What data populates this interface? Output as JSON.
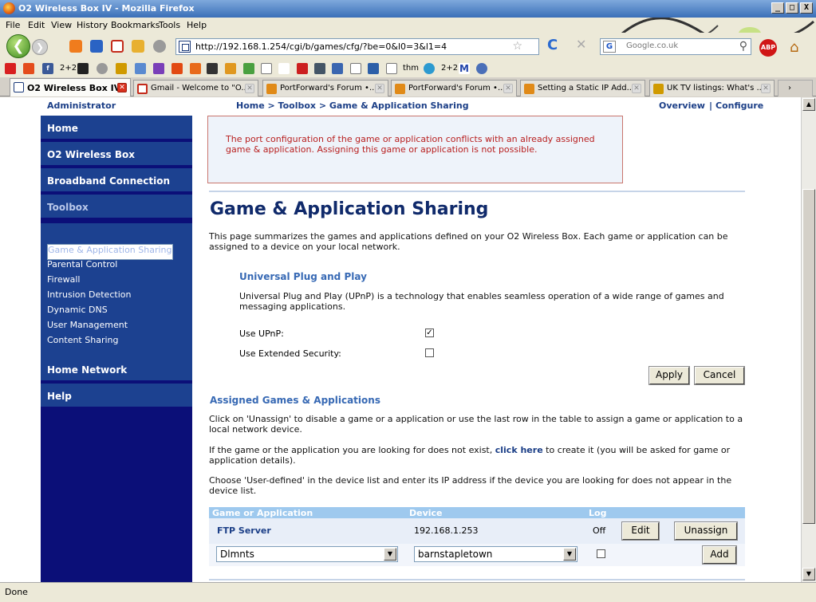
{
  "window": {
    "title": "O2 Wireless Box IV - Mozilla Firefox",
    "buttons": [
      "_",
      "□",
      "X"
    ]
  },
  "menu": [
    "File",
    "Edit",
    "View",
    "History",
    "Bookmarks",
    "Tools",
    "Help"
  ],
  "nav": {
    "url": "http://192.168.1.254/cgi/b/games/cfg/?be=0&l0=3&l1=4",
    "search_placeholder": "Google.co.uk",
    "search_engine": "G",
    "abp": "ABP"
  },
  "bookmarks": {
    "labels": [
      "2+2",
      "thm",
      "2+2"
    ]
  },
  "tabs": [
    {
      "label": "O2 Wireless Box IV",
      "active": true
    },
    {
      "label": "Gmail - Welcome to \"O..."
    },
    {
      "label": "PortForward's Forum •..."
    },
    {
      "label": "PortForward's Forum •..."
    },
    {
      "label": "Setting a Static IP Add..."
    },
    {
      "label": "UK TV listings: What's ..."
    }
  ],
  "page": {
    "topnav": {
      "left": "Administrator",
      "breadcrumb": "Home > Toolbox > Game & Application Sharing",
      "overview": "Overview",
      "sep": "|",
      "configure": "Configure"
    },
    "sidebar": {
      "items": [
        "Home",
        "O2 Wireless Box",
        "Broadband Connection",
        "Toolbox",
        "Home Network",
        "Help"
      ],
      "sub": [
        "Game & Application Sharing",
        "Parental Control",
        "Firewall",
        "Intrusion Detection",
        "Dynamic DNS",
        "User Management",
        "Content Sharing"
      ]
    },
    "error": "The port configuration of the game or application conflicts with an already assigned game & application. Assigning this game or application is not possible.",
    "heading": "Game & Application Sharing",
    "intro": "This page summarizes the games and applications defined on your O2 Wireless Box. Each game or application can be assigned to a device on your local network.",
    "upnp": {
      "title": "Universal Plug and Play",
      "desc": "Universal Plug and Play (UPnP) is a technology that enables seamless operation of a wide range of games and messaging applications.",
      "use_upnp_label": "Use UPnP:",
      "use_upnp_checked": true,
      "ext_sec_label": "Use Extended Security:",
      "ext_sec_checked": false,
      "apply": "Apply",
      "cancel": "Cancel"
    },
    "assigned": {
      "title": "Assigned Games & Applications",
      "p1": "Click on 'Unassign' to disable a game or a application or use the last row in the table to assign a game or application to a local network device.",
      "p2_before": "If the game or the application you are looking for does not exist, ",
      "p2_link": "click here",
      "p2_after": " to create it (you will be asked for game or application details).",
      "p3": "Choose 'User-defined' in the device list and enter its IP address if the device you are looking for does not appear in the device list.",
      "columns": [
        "Game or Application",
        "Device",
        "Log"
      ],
      "row": {
        "name": "FTP Server",
        "device": "192.168.1.253",
        "log": "Off",
        "edit": "Edit",
        "unassign": "Unassign"
      },
      "new_row": {
        "app": "Dlmnts",
        "device": "barnstapletown",
        "log_checked": false,
        "add": "Add"
      }
    }
  },
  "status": "Done"
}
